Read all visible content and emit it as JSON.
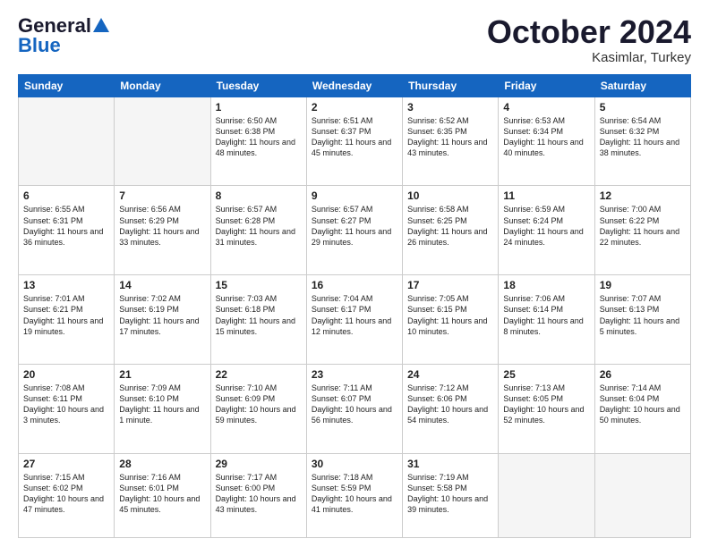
{
  "header": {
    "logo_line1": "General",
    "logo_line2": "Blue",
    "month": "October 2024",
    "location": "Kasimlar, Turkey"
  },
  "days_of_week": [
    "Sunday",
    "Monday",
    "Tuesday",
    "Wednesday",
    "Thursday",
    "Friday",
    "Saturday"
  ],
  "weeks": [
    [
      {
        "day": "",
        "empty": true
      },
      {
        "day": "",
        "empty": true
      },
      {
        "day": "1",
        "sunrise": "6:50 AM",
        "sunset": "6:38 PM",
        "daylight": "11 hours and 48 minutes."
      },
      {
        "day": "2",
        "sunrise": "6:51 AM",
        "sunset": "6:37 PM",
        "daylight": "11 hours and 45 minutes."
      },
      {
        "day": "3",
        "sunrise": "6:52 AM",
        "sunset": "6:35 PM",
        "daylight": "11 hours and 43 minutes."
      },
      {
        "day": "4",
        "sunrise": "6:53 AM",
        "sunset": "6:34 PM",
        "daylight": "11 hours and 40 minutes."
      },
      {
        "day": "5",
        "sunrise": "6:54 AM",
        "sunset": "6:32 PM",
        "daylight": "11 hours and 38 minutes."
      }
    ],
    [
      {
        "day": "6",
        "sunrise": "6:55 AM",
        "sunset": "6:31 PM",
        "daylight": "11 hours and 36 minutes."
      },
      {
        "day": "7",
        "sunrise": "6:56 AM",
        "sunset": "6:29 PM",
        "daylight": "11 hours and 33 minutes."
      },
      {
        "day": "8",
        "sunrise": "6:57 AM",
        "sunset": "6:28 PM",
        "daylight": "11 hours and 31 minutes."
      },
      {
        "day": "9",
        "sunrise": "6:57 AM",
        "sunset": "6:27 PM",
        "daylight": "11 hours and 29 minutes."
      },
      {
        "day": "10",
        "sunrise": "6:58 AM",
        "sunset": "6:25 PM",
        "daylight": "11 hours and 26 minutes."
      },
      {
        "day": "11",
        "sunrise": "6:59 AM",
        "sunset": "6:24 PM",
        "daylight": "11 hours and 24 minutes."
      },
      {
        "day": "12",
        "sunrise": "7:00 AM",
        "sunset": "6:22 PM",
        "daylight": "11 hours and 22 minutes."
      }
    ],
    [
      {
        "day": "13",
        "sunrise": "7:01 AM",
        "sunset": "6:21 PM",
        "daylight": "11 hours and 19 minutes."
      },
      {
        "day": "14",
        "sunrise": "7:02 AM",
        "sunset": "6:19 PM",
        "daylight": "11 hours and 17 minutes."
      },
      {
        "day": "15",
        "sunrise": "7:03 AM",
        "sunset": "6:18 PM",
        "daylight": "11 hours and 15 minutes."
      },
      {
        "day": "16",
        "sunrise": "7:04 AM",
        "sunset": "6:17 PM",
        "daylight": "11 hours and 12 minutes."
      },
      {
        "day": "17",
        "sunrise": "7:05 AM",
        "sunset": "6:15 PM",
        "daylight": "11 hours and 10 minutes."
      },
      {
        "day": "18",
        "sunrise": "7:06 AM",
        "sunset": "6:14 PM",
        "daylight": "11 hours and 8 minutes."
      },
      {
        "day": "19",
        "sunrise": "7:07 AM",
        "sunset": "6:13 PM",
        "daylight": "11 hours and 5 minutes."
      }
    ],
    [
      {
        "day": "20",
        "sunrise": "7:08 AM",
        "sunset": "6:11 PM",
        "daylight": "10 hours and 3 minutes."
      },
      {
        "day": "21",
        "sunrise": "7:09 AM",
        "sunset": "6:10 PM",
        "daylight": "11 hours and 1 minute."
      },
      {
        "day": "22",
        "sunrise": "7:10 AM",
        "sunset": "6:09 PM",
        "daylight": "10 hours and 59 minutes."
      },
      {
        "day": "23",
        "sunrise": "7:11 AM",
        "sunset": "6:07 PM",
        "daylight": "10 hours and 56 minutes."
      },
      {
        "day": "24",
        "sunrise": "7:12 AM",
        "sunset": "6:06 PM",
        "daylight": "10 hours and 54 minutes."
      },
      {
        "day": "25",
        "sunrise": "7:13 AM",
        "sunset": "6:05 PM",
        "daylight": "10 hours and 52 minutes."
      },
      {
        "day": "26",
        "sunrise": "7:14 AM",
        "sunset": "6:04 PM",
        "daylight": "10 hours and 50 minutes."
      }
    ],
    [
      {
        "day": "27",
        "sunrise": "7:15 AM",
        "sunset": "6:02 PM",
        "daylight": "10 hours and 47 minutes."
      },
      {
        "day": "28",
        "sunrise": "7:16 AM",
        "sunset": "6:01 PM",
        "daylight": "10 hours and 45 minutes."
      },
      {
        "day": "29",
        "sunrise": "7:17 AM",
        "sunset": "6:00 PM",
        "daylight": "10 hours and 43 minutes."
      },
      {
        "day": "30",
        "sunrise": "7:18 AM",
        "sunset": "5:59 PM",
        "daylight": "10 hours and 41 minutes."
      },
      {
        "day": "31",
        "sunrise": "7:19 AM",
        "sunset": "5:58 PM",
        "daylight": "10 hours and 39 minutes."
      },
      {
        "day": "",
        "empty": true
      },
      {
        "day": "",
        "empty": true
      }
    ]
  ]
}
